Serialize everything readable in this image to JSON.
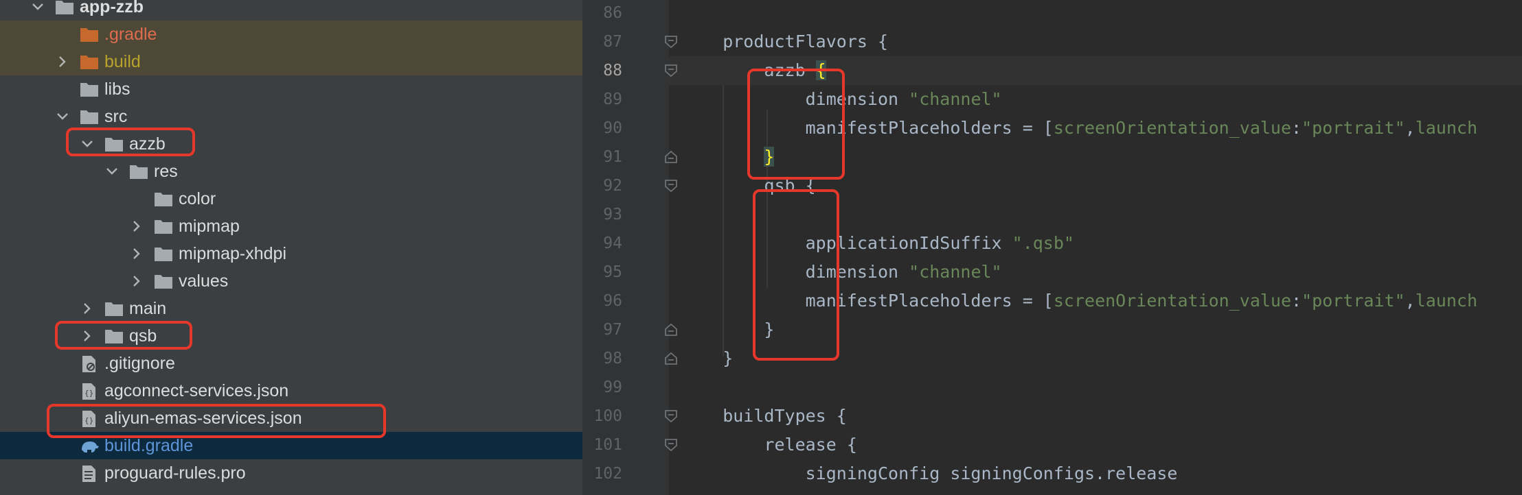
{
  "tree": {
    "rows": [
      {
        "label": "app-zzb",
        "style": "bold",
        "icon": "module-folder-icon",
        "chevron": "down",
        "state": "normal"
      },
      {
        "label": ".gradle",
        "style": "red",
        "icon": "folder-orange-icon",
        "chevron": "none",
        "state": "ignored"
      },
      {
        "label": "build",
        "style": "olive",
        "icon": "folder-orange-icon",
        "chevron": "right",
        "state": "ignored"
      },
      {
        "label": "libs",
        "style": "normal",
        "icon": "folder-icon",
        "chevron": "none",
        "state": "normal"
      },
      {
        "label": "src",
        "style": "normal",
        "icon": "folder-icon",
        "chevron": "down",
        "state": "normal"
      },
      {
        "label": "azzb",
        "style": "normal",
        "icon": "folder-icon",
        "chevron": "down",
        "state": "normal"
      },
      {
        "label": "res",
        "style": "normal",
        "icon": "folder-icon",
        "chevron": "down",
        "state": "normal"
      },
      {
        "label": "color",
        "style": "normal",
        "icon": "folder-icon",
        "chevron": "none",
        "state": "normal"
      },
      {
        "label": "mipmap",
        "style": "normal",
        "icon": "folder-icon",
        "chevron": "right",
        "state": "normal"
      },
      {
        "label": "mipmap-xhdpi",
        "style": "normal",
        "icon": "folder-icon",
        "chevron": "right",
        "state": "normal"
      },
      {
        "label": "values",
        "style": "normal",
        "icon": "folder-icon",
        "chevron": "right",
        "state": "normal"
      },
      {
        "label": "main",
        "style": "normal",
        "icon": "folder-icon",
        "chevron": "right",
        "state": "normal"
      },
      {
        "label": "qsb",
        "style": "normal",
        "icon": "folder-icon",
        "chevron": "right",
        "state": "normal"
      },
      {
        "label": ".gitignore",
        "style": "normal",
        "icon": "ignore-file-icon",
        "chevron": "none",
        "state": "normal"
      },
      {
        "label": "agconnect-services.json",
        "style": "normal",
        "icon": "json-file-icon",
        "chevron": "none",
        "state": "normal"
      },
      {
        "label": "aliyun-emas-services.json",
        "style": "normal",
        "icon": "json-file-icon",
        "chevron": "none",
        "state": "normal"
      },
      {
        "label": "build.gradle",
        "style": "blue",
        "icon": "gradle-elephant-icon",
        "chevron": "none",
        "state": "selected"
      },
      {
        "label": "proguard-rules.pro",
        "style": "normal",
        "icon": "text-file-icon",
        "chevron": "none",
        "state": "normal"
      }
    ]
  },
  "editor": {
    "current_line": "88",
    "lines": [
      {
        "num": "86",
        "fold": "none",
        "tokens": []
      },
      {
        "num": "87",
        "fold": "open",
        "tokens": [
          {
            "t": "    productFlavors {",
            "c": "plain"
          }
        ]
      },
      {
        "num": "88",
        "fold": "open",
        "tokens": [
          {
            "t": "        azzb ",
            "c": "plain"
          },
          {
            "t": "{",
            "c": "brace"
          }
        ]
      },
      {
        "num": "89",
        "fold": "none",
        "tokens": [
          {
            "t": "            dimension ",
            "c": "plain"
          },
          {
            "t": "\"channel\"",
            "c": "str"
          }
        ]
      },
      {
        "num": "90",
        "fold": "none",
        "tokens": [
          {
            "t": "            manifestPlaceholders = [",
            "c": "plain"
          },
          {
            "t": "screenOrientation_value",
            "c": "str"
          },
          {
            "t": ":",
            "c": "plain"
          },
          {
            "t": "\"portrait\"",
            "c": "str"
          },
          {
            "t": ",",
            "c": "plain"
          },
          {
            "t": "launch",
            "c": "str"
          }
        ]
      },
      {
        "num": "91",
        "fold": "close",
        "tokens": [
          {
            "t": "        ",
            "c": "plain"
          },
          {
            "t": "}",
            "c": "brace"
          }
        ]
      },
      {
        "num": "92",
        "fold": "open",
        "tokens": [
          {
            "t": "        qsb {",
            "c": "plain"
          }
        ]
      },
      {
        "num": "93",
        "fold": "none",
        "tokens": []
      },
      {
        "num": "94",
        "fold": "none",
        "tokens": [
          {
            "t": "            applicationIdSuffix ",
            "c": "plain"
          },
          {
            "t": "\".qsb\"",
            "c": "str"
          }
        ]
      },
      {
        "num": "95",
        "fold": "none",
        "tokens": [
          {
            "t": "            dimension ",
            "c": "plain"
          },
          {
            "t": "\"channel\"",
            "c": "str"
          }
        ]
      },
      {
        "num": "96",
        "fold": "none",
        "tokens": [
          {
            "t": "            manifestPlaceholders = [",
            "c": "plain"
          },
          {
            "t": "screenOrientation_value",
            "c": "str"
          },
          {
            "t": ":",
            "c": "plain"
          },
          {
            "t": "\"portrait\"",
            "c": "str"
          },
          {
            "t": ",",
            "c": "plain"
          },
          {
            "t": "launch",
            "c": "str"
          }
        ]
      },
      {
        "num": "97",
        "fold": "close",
        "tokens": [
          {
            "t": "        }",
            "c": "plain"
          }
        ]
      },
      {
        "num": "98",
        "fold": "close",
        "tokens": [
          {
            "t": "    }",
            "c": "plain"
          }
        ]
      },
      {
        "num": "99",
        "fold": "none",
        "tokens": []
      },
      {
        "num": "100",
        "fold": "open",
        "tokens": [
          {
            "t": "    buildTypes {",
            "c": "plain"
          }
        ]
      },
      {
        "num": "101",
        "fold": "open",
        "tokens": [
          {
            "t": "        release {",
            "c": "plain"
          }
        ]
      },
      {
        "num": "102",
        "fold": "none",
        "tokens": [
          {
            "t": "            signingConfig signingConfigs.release",
            "c": "plain"
          }
        ]
      }
    ]
  },
  "colors": {
    "tree_bg": "#3c3f41",
    "editor_bg": "#2b2b2b",
    "highlight_red": "#e5382b",
    "string_green": "#6a8759"
  }
}
